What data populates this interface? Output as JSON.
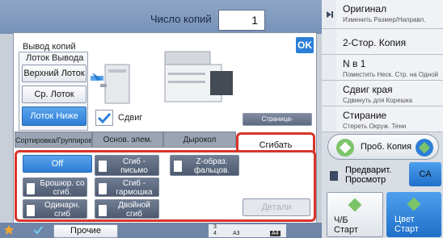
{
  "header": {
    "copies_label": "Число копий",
    "copies_value": "1"
  },
  "right_panel": {
    "items": [
      {
        "title": "Оригинал",
        "sub": "Изменить Размер/Направл."
      },
      {
        "title": "2-Стор. Копия",
        "sub": ""
      },
      {
        "title": "N в 1",
        "sub": "Поместить Неск. Стр. на Одной"
      },
      {
        "title": "Сдвиг края",
        "sub": "Сдвинуть для Корешка"
      },
      {
        "title": "Стирание",
        "sub": "Стереть Окруж. Тени"
      }
    ],
    "preview_copy": "Проб. Копия",
    "preview_label": "Предварит. Просмотр",
    "ca": "CA",
    "bw_start": "Ч/Б Старт",
    "color_start": "Цвет Старт"
  },
  "dialog": {
    "title": "Вывод копий",
    "ok": "OK",
    "tray_group_label": "Лоток Вывода",
    "trays": [
      "Верхний Лоток",
      "Ср. Лоток",
      "Лоток Ниже"
    ],
    "selected_tray": "Лоток Ниже",
    "shift_label": "Сдвиг",
    "shift_checked": true,
    "separator_button": "Страница-разделитель",
    "tabs": [
      "Сортировка/Группировка",
      "Основ. элем.",
      "Дырокол",
      "Сгибать"
    ],
    "active_tab": "Сгибать",
    "fold_options": {
      "off": "Off",
      "letter": "Сгиб - письмо",
      "zfold": "Z-образ. фальцов.",
      "brochure": "Брошюр. со сгиб.",
      "accordion": "Сгиб - гармошка",
      "single": "Одинарн. сгиб",
      "double": "Двойной сгиб"
    },
    "details": "Детали"
  },
  "bottom": {
    "other": "Прочие",
    "tray_rows": [
      "3",
      "4",
      "A3",
      "A4"
    ]
  },
  "colors": {
    "accent": "#2c7fd6",
    "highlight": "#d9342b",
    "panel": "#d9dde4"
  }
}
